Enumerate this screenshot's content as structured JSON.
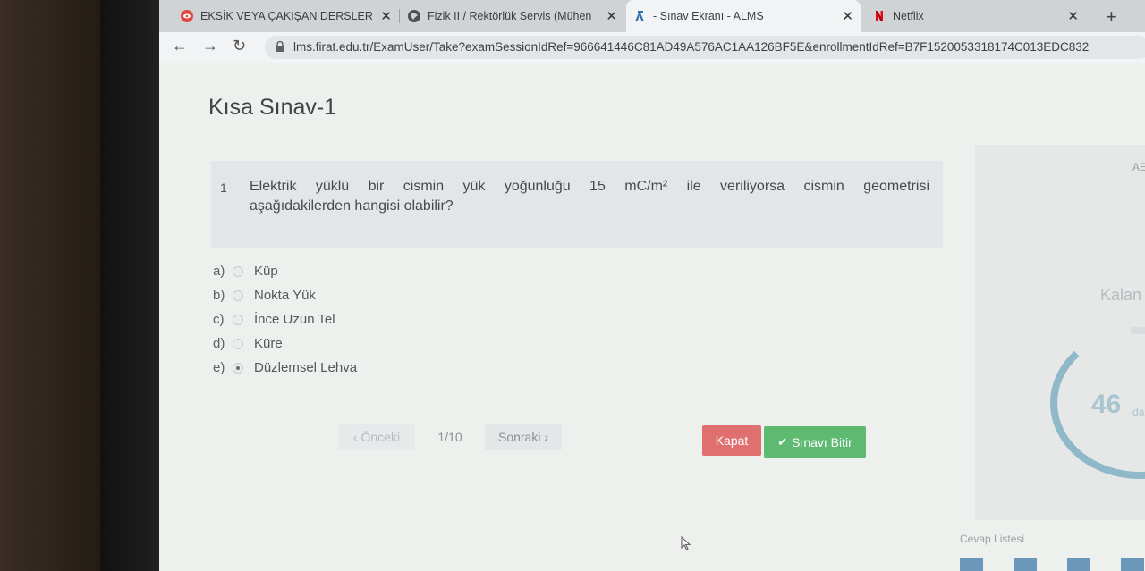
{
  "browser": {
    "tabs": [
      {
        "label": "EKSİK VEYA ÇAKIŞAN DERSLER H",
        "icon": "red-eye-icon"
      },
      {
        "label": "Fizik II / Rektörlük Servis (Mühen",
        "icon": "globe-icon"
      },
      {
        "label": "- Sınav Ekranı - ALMS",
        "icon": "alms-icon"
      },
      {
        "label": "Netflix",
        "icon": "netflix-icon"
      }
    ],
    "url": "lms.firat.edu.tr/ExamUser/Take?examSessionIdRef=966641446C81AD49A576AC1AA126BF5E&enrollmentIdRef=B7F1520053318174C013EDC832"
  },
  "exam": {
    "title": "Kısa Sınav-1",
    "question": {
      "number": "1 -",
      "line1": "Elektrik yüklü bir cismin yük yoğunluğu 15 mC/m² ile veriliyorsa cismin geometrisi",
      "line2": "aşağıdakilerden hangisi olabilir?"
    },
    "options": [
      {
        "letter": "a)",
        "text": "Küp",
        "selected": false
      },
      {
        "letter": "b)",
        "text": "Nokta Yük",
        "selected": false
      },
      {
        "letter": "c)",
        "text": "İnce Uzun Tel",
        "selected": false
      },
      {
        "letter": "d)",
        "text": "Küre",
        "selected": false
      },
      {
        "letter": "e)",
        "text": "Düzlemsel Lehva",
        "selected": true
      }
    ],
    "pager": {
      "prev": "Önceki",
      "page": "1/10",
      "next": "Sonraki"
    },
    "close_label": "Kapat",
    "finish_label": "Sınavı Bitir"
  },
  "side": {
    "top_text": "AE",
    "remaining_label": "Kalan",
    "timer_value": "46",
    "timer_unit": "da",
    "answer_list_title": "Cevap Listesi"
  },
  "colors": {
    "close_button": "#e07070",
    "finish_button": "#5dba70",
    "timer": "#8fb8c8"
  }
}
